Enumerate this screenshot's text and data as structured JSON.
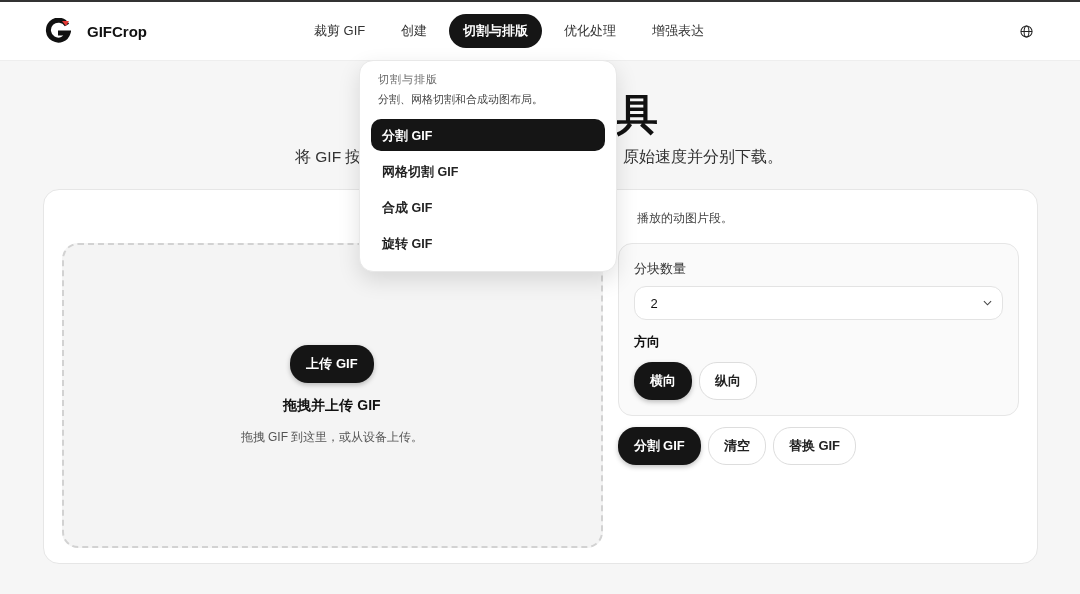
{
  "header": {
    "brand": "GIFCrop",
    "nav": [
      {
        "label": "裁剪 GIF",
        "selected": false
      },
      {
        "label": "创建",
        "selected": false
      },
      {
        "label": "切割与排版",
        "selected": true
      },
      {
        "label": "优化处理",
        "selected": false
      },
      {
        "label": "增强表达",
        "selected": false
      }
    ]
  },
  "menu": {
    "title": "切割与排版",
    "description": "分割、网格切割和合成动图布局。",
    "items": [
      {
        "label": "分割 GIF",
        "selected": true
      },
      {
        "label": "网格切割 GIF",
        "selected": false
      },
      {
        "label": "合成 GIF",
        "selected": false
      },
      {
        "label": "旋转 GIF",
        "selected": false
      }
    ]
  },
  "hero": {
    "title": "具",
    "subtitle_left": "将 GIF 按",
    "subtitle_right": "原始速度并分别下载。"
  },
  "card": {
    "description": "播放的动图片段。",
    "dropzone": {
      "button": "上传 GIF",
      "heading": "拖拽并上传 GIF",
      "hint": "拖拽 GIF 到这里，或从设备上传。"
    },
    "settings": {
      "count_label": "分块数量",
      "count_value": "2",
      "direction_label": "方向",
      "directions": [
        {
          "label": "横向",
          "selected": true
        },
        {
          "label": "纵向",
          "selected": false
        }
      ]
    },
    "actions": [
      {
        "label": "分割 GIF",
        "kind": "primary"
      },
      {
        "label": "清空",
        "kind": "secondary"
      },
      {
        "label": "替换 GIF",
        "kind": "secondary"
      }
    ]
  }
}
